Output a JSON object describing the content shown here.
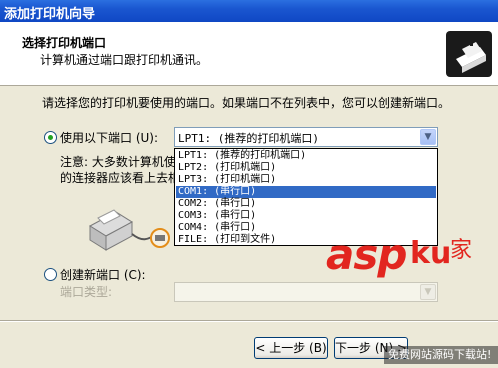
{
  "window": {
    "title": "添加打印机向导"
  },
  "header": {
    "title": "选择打印机端口",
    "subtitle": "计算机通过端口跟打印机通讯。"
  },
  "main": {
    "instruction": "请选择您的打印机要使用的端口。如果端口不在列表中，您可以创建新端口。",
    "use_port_label": "使用以下端口 (U):",
    "selected_port": "LPT1: (推荐的打印机端口)",
    "note_line1": "注意: 大多数计算机使",
    "note_line2": "的连接器应该看上去相",
    "port_options": [
      "LPT1: (推荐的打印机端口)",
      "LPT2: (打印机端口)",
      "LPT3: (打印机端口)",
      "COM1: (串行口)",
      "COM2: (串行口)",
      "COM3: (串行口)",
      "COM4: (串行口)",
      "FILE: (打印到文件)"
    ],
    "highlighted_option_index": 3,
    "create_port_label": "创建新端口 (C):",
    "port_type_label": "端口类型:",
    "port_type_value": ""
  },
  "buttons": {
    "back": "< 上一步 (B)",
    "next": "下一步 (N) >"
  },
  "watermark": {
    "brand": "asp",
    "brand_suffix": "ku",
    "brand_cn": "家",
    "sub": "免费网站源码下载站!"
  },
  "colors": {
    "title_bar": "#0f47c4",
    "highlight": "#316ac5",
    "radio_dot": "#21a121",
    "watermark": "#e2261f"
  }
}
